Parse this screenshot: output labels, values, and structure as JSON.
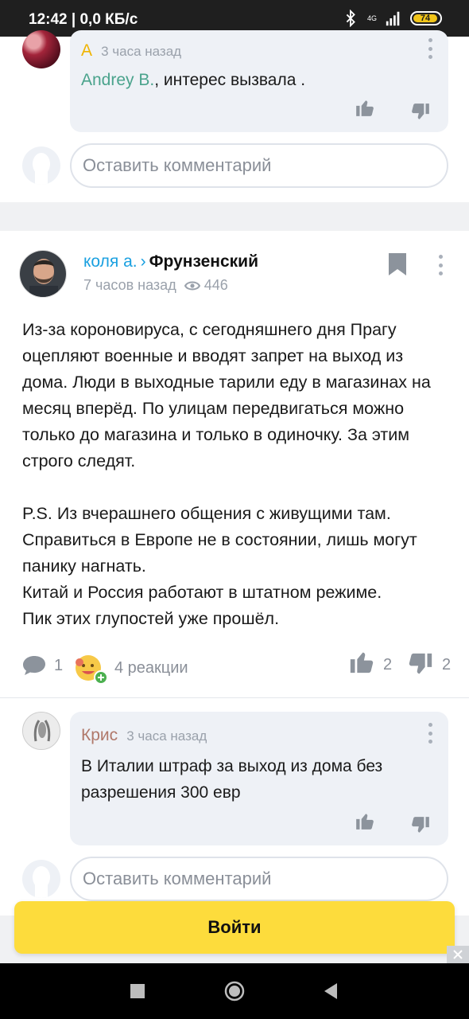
{
  "status_bar": {
    "time": "12:42 | 0,0 КБ/с",
    "network": "4G",
    "battery": "74"
  },
  "reply_top": {
    "author_initial": "А",
    "time_ago": "3 часа назад",
    "mention": "Andrey B.",
    "text": ", интерес вызвала ."
  },
  "comment_input_1": {
    "placeholder": "Оставить комментарий"
  },
  "post": {
    "author_name": "коля а.",
    "chevron": "›",
    "place": "Фрунзенский",
    "time_ago": "7 часов назад",
    "views": "446",
    "paragraphs": [
      "Из-за короновируса, с сегодняшнего дня Прагу оцепляют военные и вводят запрет на выход из дома. Люди в выходные тарили еду в магазинах на месяц вперёд. По улицам передвигаться можно только до магазина и только в одиночку. За этим строго следят.",
      "P.S. Из вчерашнего общения с живущими там. Справиться в Европе не в состоянии, лишь могут панику нагнать.",
      "Китай и Россия работают в штатном режиме.",
      "Пик этих глупостей уже прошёл."
    ],
    "comments_count": "1",
    "reactions": "4 реакции",
    "likes": "2",
    "dislikes": "2"
  },
  "reply_kris": {
    "author": "Крис",
    "time_ago": "3 часа назад",
    "text": "В Италии штраф за выход из дома без разрешения 300 евр"
  },
  "comment_input_2": {
    "placeholder": "Оставить комментарий"
  },
  "login_button": "Войти",
  "colors": {
    "author_initial": "#f0b400",
    "mention": "#4aa38c",
    "post_author": "#1aa0e0",
    "kris": "#b0786a",
    "login": "#fddc3c"
  }
}
